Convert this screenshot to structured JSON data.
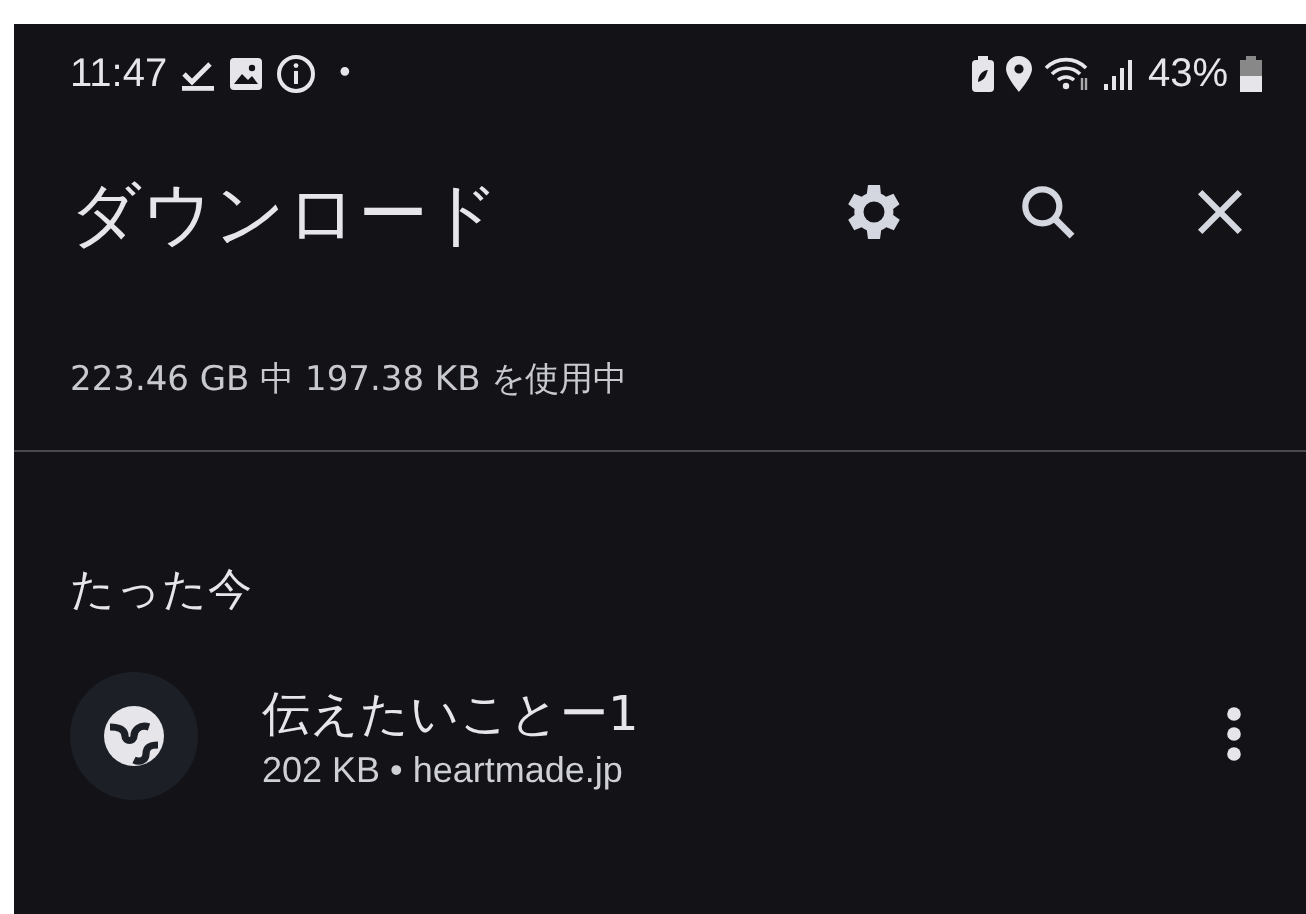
{
  "status_bar": {
    "time": "11:47",
    "dot": "•",
    "battery": "43%"
  },
  "app_bar": {
    "title": "ダウンロード"
  },
  "storage": "223.46 GB 中 197.38 KB を使用中",
  "section": {
    "title": "たった今",
    "items": [
      {
        "title": "伝えたいことー1",
        "subtitle": "202 KB • heartmade.jp"
      }
    ]
  }
}
